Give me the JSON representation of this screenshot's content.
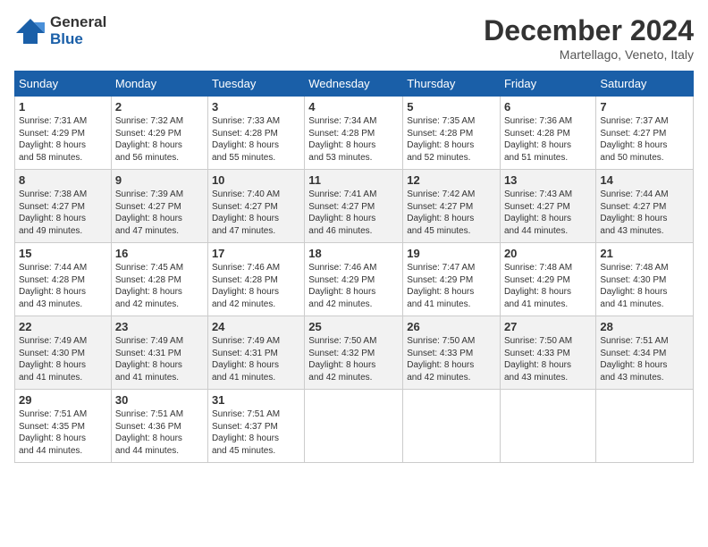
{
  "header": {
    "logo_line1": "General",
    "logo_line2": "Blue",
    "month": "December 2024",
    "location": "Martellago, Veneto, Italy"
  },
  "days_of_week": [
    "Sunday",
    "Monday",
    "Tuesday",
    "Wednesday",
    "Thursday",
    "Friday",
    "Saturday"
  ],
  "weeks": [
    [
      {
        "day": "1",
        "info": "Sunrise: 7:31 AM\nSunset: 4:29 PM\nDaylight: 8 hours\nand 58 minutes."
      },
      {
        "day": "2",
        "info": "Sunrise: 7:32 AM\nSunset: 4:29 PM\nDaylight: 8 hours\nand 56 minutes."
      },
      {
        "day": "3",
        "info": "Sunrise: 7:33 AM\nSunset: 4:28 PM\nDaylight: 8 hours\nand 55 minutes."
      },
      {
        "day": "4",
        "info": "Sunrise: 7:34 AM\nSunset: 4:28 PM\nDaylight: 8 hours\nand 53 minutes."
      },
      {
        "day": "5",
        "info": "Sunrise: 7:35 AM\nSunset: 4:28 PM\nDaylight: 8 hours\nand 52 minutes."
      },
      {
        "day": "6",
        "info": "Sunrise: 7:36 AM\nSunset: 4:28 PM\nDaylight: 8 hours\nand 51 minutes."
      },
      {
        "day": "7",
        "info": "Sunrise: 7:37 AM\nSunset: 4:27 PM\nDaylight: 8 hours\nand 50 minutes."
      }
    ],
    [
      {
        "day": "8",
        "info": "Sunrise: 7:38 AM\nSunset: 4:27 PM\nDaylight: 8 hours\nand 49 minutes."
      },
      {
        "day": "9",
        "info": "Sunrise: 7:39 AM\nSunset: 4:27 PM\nDaylight: 8 hours\nand 47 minutes."
      },
      {
        "day": "10",
        "info": "Sunrise: 7:40 AM\nSunset: 4:27 PM\nDaylight: 8 hours\nand 47 minutes."
      },
      {
        "day": "11",
        "info": "Sunrise: 7:41 AM\nSunset: 4:27 PM\nDaylight: 8 hours\nand 46 minutes."
      },
      {
        "day": "12",
        "info": "Sunrise: 7:42 AM\nSunset: 4:27 PM\nDaylight: 8 hours\nand 45 minutes."
      },
      {
        "day": "13",
        "info": "Sunrise: 7:43 AM\nSunset: 4:27 PM\nDaylight: 8 hours\nand 44 minutes."
      },
      {
        "day": "14",
        "info": "Sunrise: 7:44 AM\nSunset: 4:27 PM\nDaylight: 8 hours\nand 43 minutes."
      }
    ],
    [
      {
        "day": "15",
        "info": "Sunrise: 7:44 AM\nSunset: 4:28 PM\nDaylight: 8 hours\nand 43 minutes."
      },
      {
        "day": "16",
        "info": "Sunrise: 7:45 AM\nSunset: 4:28 PM\nDaylight: 8 hours\nand 42 minutes."
      },
      {
        "day": "17",
        "info": "Sunrise: 7:46 AM\nSunset: 4:28 PM\nDaylight: 8 hours\nand 42 minutes."
      },
      {
        "day": "18",
        "info": "Sunrise: 7:46 AM\nSunset: 4:29 PM\nDaylight: 8 hours\nand 42 minutes."
      },
      {
        "day": "19",
        "info": "Sunrise: 7:47 AM\nSunset: 4:29 PM\nDaylight: 8 hours\nand 41 minutes."
      },
      {
        "day": "20",
        "info": "Sunrise: 7:48 AM\nSunset: 4:29 PM\nDaylight: 8 hours\nand 41 minutes."
      },
      {
        "day": "21",
        "info": "Sunrise: 7:48 AM\nSunset: 4:30 PM\nDaylight: 8 hours\nand 41 minutes."
      }
    ],
    [
      {
        "day": "22",
        "info": "Sunrise: 7:49 AM\nSunset: 4:30 PM\nDaylight: 8 hours\nand 41 minutes."
      },
      {
        "day": "23",
        "info": "Sunrise: 7:49 AM\nSunset: 4:31 PM\nDaylight: 8 hours\nand 41 minutes."
      },
      {
        "day": "24",
        "info": "Sunrise: 7:49 AM\nSunset: 4:31 PM\nDaylight: 8 hours\nand 41 minutes."
      },
      {
        "day": "25",
        "info": "Sunrise: 7:50 AM\nSunset: 4:32 PM\nDaylight: 8 hours\nand 42 minutes."
      },
      {
        "day": "26",
        "info": "Sunrise: 7:50 AM\nSunset: 4:33 PM\nDaylight: 8 hours\nand 42 minutes."
      },
      {
        "day": "27",
        "info": "Sunrise: 7:50 AM\nSunset: 4:33 PM\nDaylight: 8 hours\nand 43 minutes."
      },
      {
        "day": "28",
        "info": "Sunrise: 7:51 AM\nSunset: 4:34 PM\nDaylight: 8 hours\nand 43 minutes."
      }
    ],
    [
      {
        "day": "29",
        "info": "Sunrise: 7:51 AM\nSunset: 4:35 PM\nDaylight: 8 hours\nand 44 minutes."
      },
      {
        "day": "30",
        "info": "Sunrise: 7:51 AM\nSunset: 4:36 PM\nDaylight: 8 hours\nand 44 minutes."
      },
      {
        "day": "31",
        "info": "Sunrise: 7:51 AM\nSunset: 4:37 PM\nDaylight: 8 hours\nand 45 minutes."
      },
      {
        "day": "",
        "info": ""
      },
      {
        "day": "",
        "info": ""
      },
      {
        "day": "",
        "info": ""
      },
      {
        "day": "",
        "info": ""
      }
    ]
  ]
}
